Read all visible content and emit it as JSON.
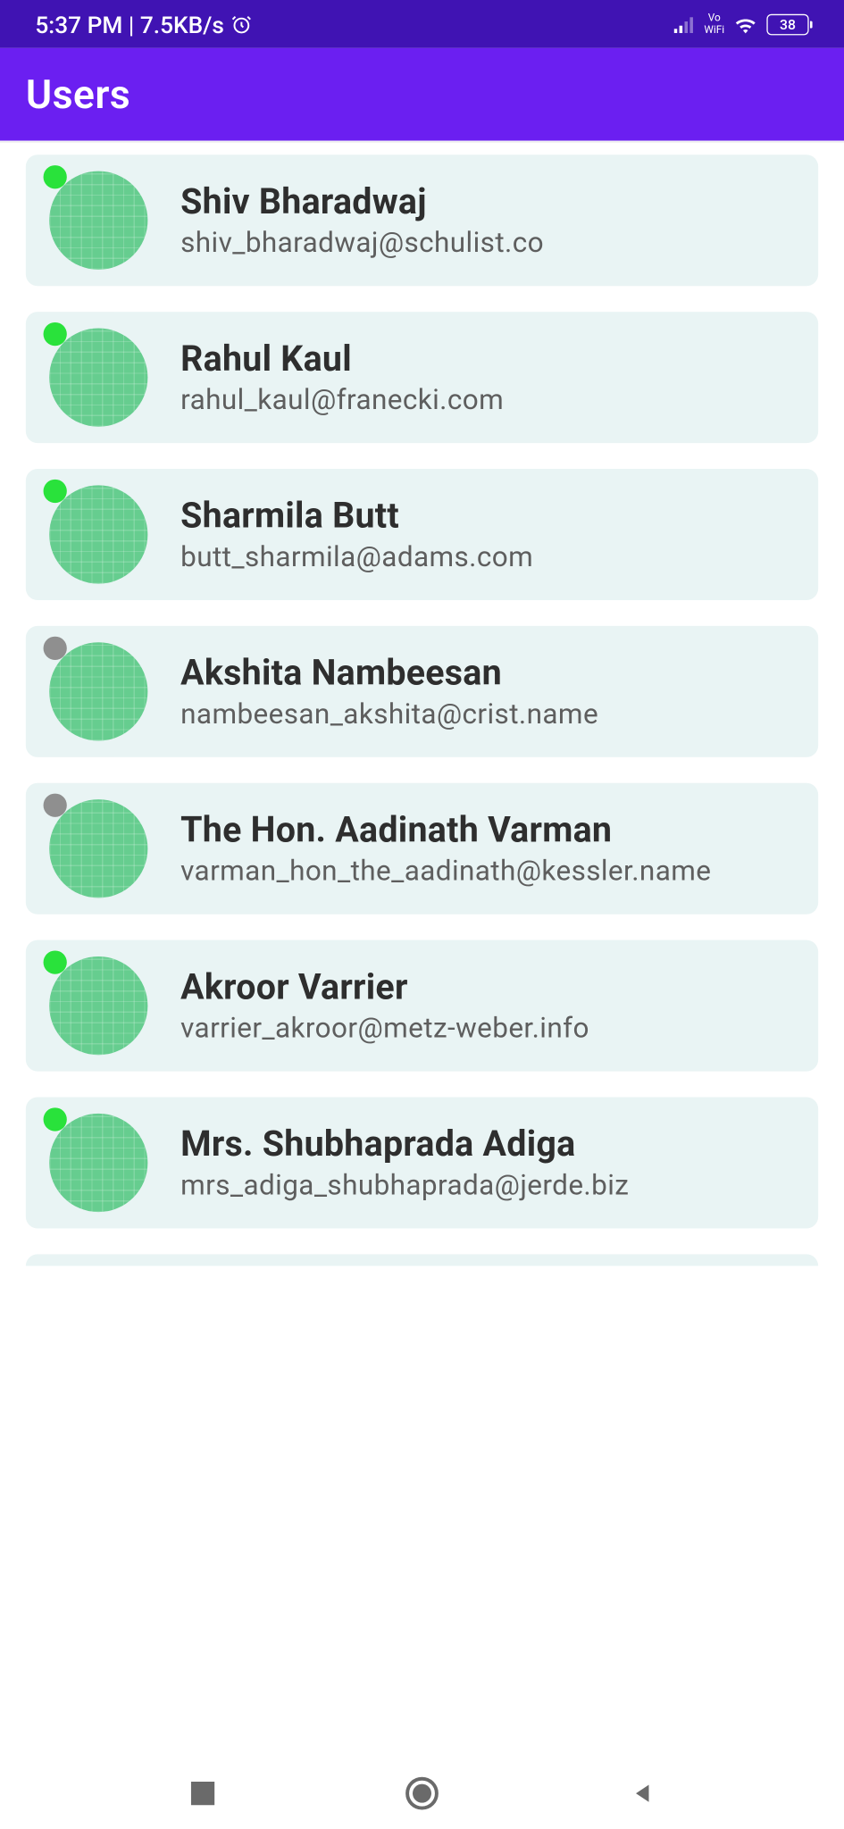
{
  "status_bar": {
    "time_rate": "5:37 PM | 7.5KB/s",
    "battery": "38",
    "vo_wifi_top": "Vo",
    "vo_wifi_bottom": "WiFi"
  },
  "header": {
    "title": "Users"
  },
  "users": [
    {
      "name": "Shiv Bharadwaj",
      "email": "shiv_bharadwaj@schulist.co",
      "online": true
    },
    {
      "name": "Rahul Kaul",
      "email": "rahul_kaul@franecki.com",
      "online": true
    },
    {
      "name": "Sharmila Butt",
      "email": "butt_sharmila@adams.com",
      "online": true
    },
    {
      "name": "Akshita Nambeesan",
      "email": "nambeesan_akshita@crist.name",
      "online": false
    },
    {
      "name": "The Hon. Aadinath Varman",
      "email": "varman_hon_the_aadinath@kessler.name",
      "online": false
    },
    {
      "name": "Akroor Varrier",
      "email": "varrier_akroor@metz-weber.info",
      "online": true
    },
    {
      "name": "Mrs. Shubhaprada Adiga",
      "email": "mrs_adiga_shubhaprada@jerde.biz",
      "online": true
    }
  ]
}
